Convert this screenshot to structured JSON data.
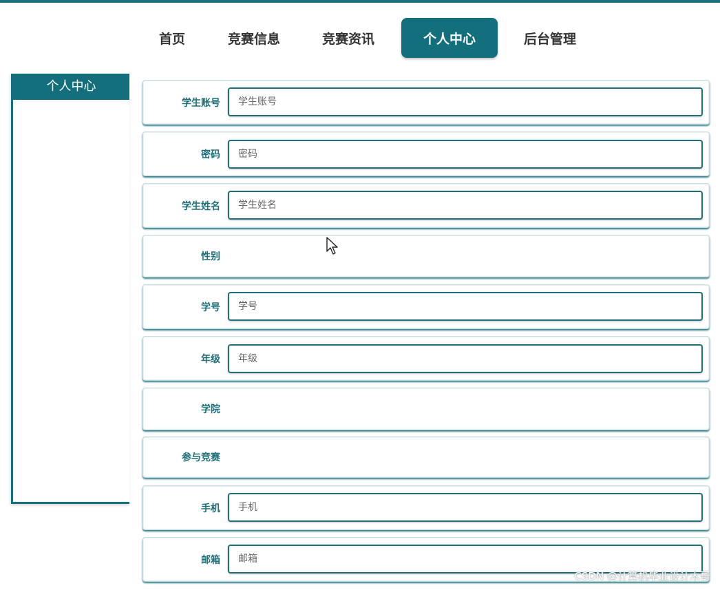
{
  "nav": {
    "items": [
      {
        "label": "首页"
      },
      {
        "label": "竞赛信息"
      },
      {
        "label": "竞赛资讯"
      },
      {
        "label": "个人中心"
      },
      {
        "label": "后台管理"
      }
    ],
    "active_index": 3
  },
  "sidebar": {
    "title": "个人中心"
  },
  "form": {
    "rows": [
      {
        "label": "学生账号",
        "placeholder": "学生账号",
        "value": ""
      },
      {
        "label": "密码",
        "placeholder": "密码",
        "value": ""
      },
      {
        "label": "学生姓名",
        "placeholder": "学生姓名",
        "value": ""
      },
      {
        "label": "性别"
      },
      {
        "label": "学号",
        "placeholder": "学号",
        "value": ""
      },
      {
        "label": "年级",
        "placeholder": "年级",
        "value": ""
      },
      {
        "label": "学院"
      },
      {
        "label": "参与竞赛"
      },
      {
        "label": "手机",
        "placeholder": "手机",
        "value": ""
      },
      {
        "label": "邮箱",
        "placeholder": "邮箱",
        "value": ""
      }
    ]
  },
  "watermark": "CSDN @计算机毕业设计木哥",
  "colors": {
    "accent": "#136f7b",
    "label": "#1d6f7a",
    "nav_text": "#333333"
  }
}
